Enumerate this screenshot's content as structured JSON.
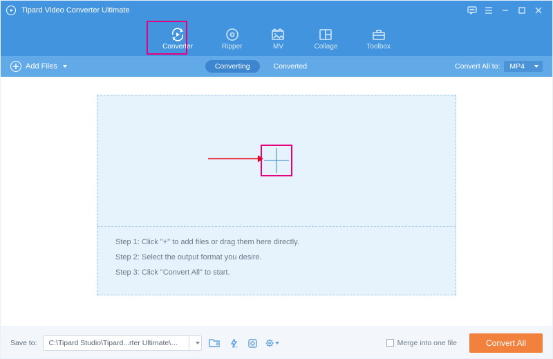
{
  "titlebar": {
    "title": "Tipard Video Converter Ultimate"
  },
  "nav": {
    "items": [
      {
        "label": "Converter"
      },
      {
        "label": "Ripper"
      },
      {
        "label": "MV"
      },
      {
        "label": "Collage"
      },
      {
        "label": "Toolbox"
      }
    ]
  },
  "toolbar": {
    "add_files": "Add Files",
    "seg_converting": "Converting",
    "seg_converted": "Converted",
    "convert_all_to": "Convert All to:",
    "format": "MP4"
  },
  "drop": {
    "step1": "Step 1: Click \"+\" to add files or drag them here directly.",
    "step2": "Step 2: Select the output format you desire.",
    "step3": "Step 3: Click \"Convert All\" to start."
  },
  "bottom": {
    "save_to_label": "Save to:",
    "path": "C:\\Tipard Studio\\Tipard...rter Ultimate\\Converted",
    "merge_label": "Merge into one file",
    "convert_all": "Convert All"
  }
}
